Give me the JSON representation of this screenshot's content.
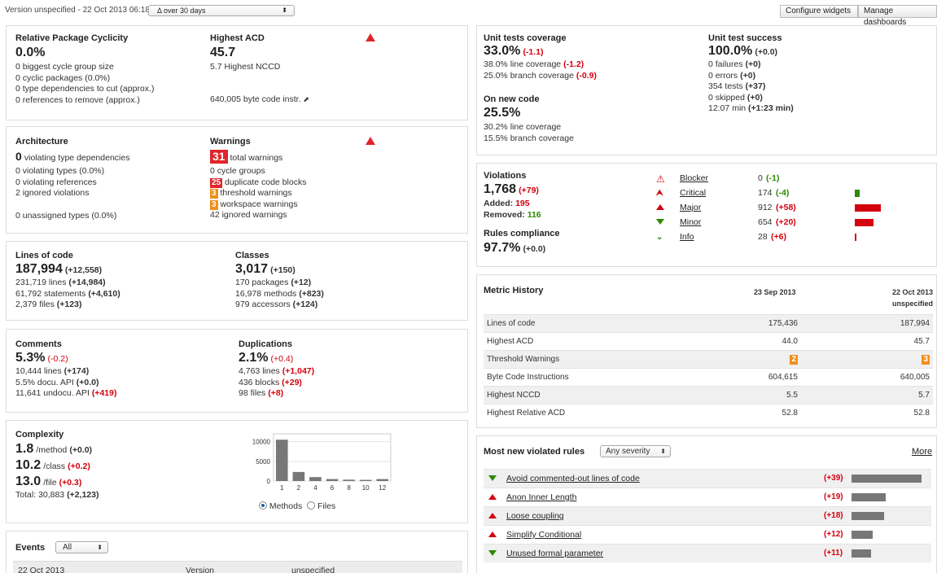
{
  "topbar": {
    "version_text": "Version unspecified - 22 Oct 2013 06:18",
    "period_select": "Δ over 30 days",
    "configure_widgets": "Configure widgets",
    "manage_dashboards": "Manage dashboards"
  },
  "cyclicity": {
    "title": "Relative Package Cyclicity",
    "value": "0.0%",
    "lines": [
      "0 biggest cycle group size",
      "0 cyclic packages (0.0%)",
      "0 type dependencies to cut (approx.)",
      "0 references to remove (approx.)"
    ]
  },
  "acd": {
    "title": "Highest ACD",
    "value": "45.7",
    "line1": "5.7 Highest NCCD",
    "bytecode": "640,005 byte code instr."
  },
  "architecture": {
    "title": "Architecture",
    "value": "0",
    "value_label": "violating type dependencies",
    "lines": [
      "0 violating types (0.0%)",
      "0 violating references",
      "2 ignored violations"
    ],
    "unassigned": "0 unassigned types (0.0%)"
  },
  "warnings": {
    "title": "Warnings",
    "total_count": "31",
    "total_label": "total warnings",
    "cycle_groups": "0 cycle groups",
    "dup_count": "25",
    "dup_label": "duplicate code blocks",
    "threshold_count": "3",
    "threshold_label": "threshold warnings",
    "workspace_count": "3",
    "workspace_label": "workspace warnings",
    "ignored": "42 ignored warnings"
  },
  "loc": {
    "title": "Lines of code",
    "value": "187,994",
    "delta": "(+12,558)",
    "lines": [
      {
        "text": "231,719 lines",
        "delta": "(+14,984)"
      },
      {
        "text": "61,792 statements",
        "delta": "(+4,610)"
      },
      {
        "text": "2,379 files",
        "delta": "(+123)"
      }
    ]
  },
  "classes": {
    "title": "Classes",
    "value": "3,017",
    "delta": "(+150)",
    "lines": [
      {
        "text": "170 packages",
        "delta": "(+12)"
      },
      {
        "text": "16,978 methods",
        "delta": "(+823)"
      },
      {
        "text": "979 accessors",
        "delta": "(+124)"
      }
    ]
  },
  "comments": {
    "title": "Comments",
    "value": "5.3%",
    "delta": "(-0.2)",
    "lines": [
      {
        "text": "10,444 lines",
        "delta": "(+174)",
        "color": "black"
      },
      {
        "text": "5.5% docu. API",
        "delta": "(+0.0)",
        "color": "black"
      },
      {
        "text": "11,641 undocu. API",
        "delta": "(+419)",
        "color": "red"
      }
    ]
  },
  "duplications": {
    "title": "Duplications",
    "value": "2.1%",
    "delta": "(+0.4)",
    "lines": [
      {
        "text": "4,763 lines",
        "delta": "(+1,047)"
      },
      {
        "text": "436 blocks",
        "delta": "(+29)"
      },
      {
        "text": "98 files",
        "delta": "(+8)"
      }
    ]
  },
  "complexity": {
    "title": "Complexity",
    "method_value": "1.8",
    "method_unit": "/method",
    "method_delta": "(+0.0)",
    "class_value": "10.2",
    "class_unit": "/class",
    "class_delta": "(+0.2)",
    "file_value": "13.0",
    "file_unit": "/file",
    "file_delta": "(+0.3)",
    "total": "Total: 30,883",
    "total_delta": "(+2,123)",
    "radio_methods": "Methods",
    "radio_files": "Files"
  },
  "chart_data": {
    "type": "bar",
    "categories": [
      "1",
      "2",
      "4",
      "6",
      "8",
      "10",
      "12"
    ],
    "values": [
      10500,
      2300,
      1000,
      500,
      350,
      300,
      500
    ],
    "ylim": [
      0,
      12000
    ],
    "yticks": [
      "10000",
      "5000",
      "0"
    ],
    "ytick_values": [
      10000,
      5000,
      0
    ],
    "grid": true,
    "color": "#777777"
  },
  "events": {
    "title": "Events",
    "filter": "All",
    "row": {
      "date": "22 Oct 2013",
      "type": "Version",
      "name": "unspecified"
    }
  },
  "tests": {
    "coverage_title": "Unit tests coverage",
    "coverage_value": "33.0%",
    "coverage_delta": "(-1.1)",
    "line_cov": "38.0% line coverage",
    "line_cov_delta": "(-1.2)",
    "branch_cov": "25.0% branch coverage",
    "branch_cov_delta": "(-0.9)",
    "new_code_title": "On new code",
    "new_code_value": "25.5%",
    "new_line_cov": "30.2% line coverage",
    "new_branch_cov": "15.5% branch coverage",
    "success_title": "Unit test success",
    "success_value": "100.0%",
    "success_delta": "(+0.0)",
    "lines": [
      {
        "text": "0 failures",
        "delta": "(+0)"
      },
      {
        "text": "0 errors",
        "delta": "(+0)"
      },
      {
        "text": "354 tests",
        "delta": "(+37)"
      },
      {
        "text": "0 skipped",
        "delta": "(+0)"
      },
      {
        "text": "12:07 min",
        "delta": "(+1:23 min)"
      }
    ]
  },
  "violations": {
    "title": "Violations",
    "value": "1,768",
    "delta": "(+79)",
    "added_label": "Added:",
    "added": "195",
    "removed_label": "Removed:",
    "removed": "116",
    "compliance_title": "Rules compliance",
    "compliance_value": "97.7%",
    "compliance_delta": "(+0.0)",
    "severities": [
      {
        "name": "Blocker",
        "count": "0",
        "delta": "(-1)",
        "delta_color": "green",
        "icon": "blocker-icon",
        "bar": 0
      },
      {
        "name": "Critical",
        "count": "174",
        "delta": "(-4)",
        "delta_color": "green",
        "icon": "critical-icon",
        "bar": 174
      },
      {
        "name": "Major",
        "count": "912",
        "delta": "(+58)",
        "delta_color": "red",
        "icon": "major-icon",
        "bar": 912
      },
      {
        "name": "Minor",
        "count": "654",
        "delta": "(+20)",
        "delta_color": "red",
        "icon": "minor-icon",
        "bar": 654
      },
      {
        "name": "Info",
        "count": "28",
        "delta": "(+6)",
        "delta_color": "red",
        "icon": "info-icon",
        "bar": 28
      }
    ]
  },
  "history": {
    "title": "Metric History",
    "col1": "23 Sep 2013",
    "col2": "22 Oct 2013",
    "col2_sub": "unspecified",
    "rows": [
      {
        "label": "Lines of code",
        "v1": "175,436",
        "v2": "187,994"
      },
      {
        "label": "Highest ACD",
        "v1": "44.0",
        "v2": "45.7"
      },
      {
        "label": "Threshold Warnings",
        "v1": "2",
        "v2": "3"
      },
      {
        "label": "Byte Code Instructions",
        "v1": "604,615",
        "v2": "640,005"
      },
      {
        "label": "Highest NCCD",
        "v1": "5.5",
        "v2": "5.7"
      },
      {
        "label": "Highest Relative ACD",
        "v1": "52.8",
        "v2": "52.8"
      }
    ]
  },
  "rules": {
    "title": "Most new violated rules",
    "severity_filter": "Any severity",
    "more": "More",
    "items": [
      {
        "name": "Avoid commented-out lines of code",
        "delta": "(+39)",
        "count": 39,
        "icon": "minor-icon"
      },
      {
        "name": "Anon Inner Length",
        "delta": "(+19)",
        "count": 19,
        "icon": "major-icon"
      },
      {
        "name": "Loose coupling",
        "delta": "(+18)",
        "count": 18,
        "icon": "major-icon"
      },
      {
        "name": "Simplify Conditional",
        "delta": "(+12)",
        "count": 12,
        "icon": "major-icon"
      },
      {
        "name": "Unused formal parameter",
        "delta": "(+11)",
        "count": 11,
        "icon": "minor-icon"
      }
    ]
  }
}
